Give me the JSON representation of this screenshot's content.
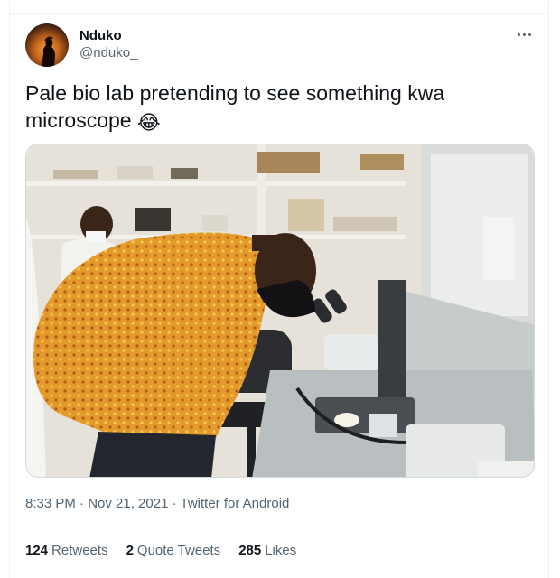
{
  "tweet": {
    "display_name": "Nduko",
    "handle": "@nduko_",
    "text": "Pale bio lab pretending to see something kwa microscope",
    "emoji": "😂",
    "timestamp": "8:33 PM · Nov 21, 2021 · Twitter for Android",
    "retweets_count": "124",
    "retweets_label": "Retweets",
    "quote_count": "2",
    "quote_label": "Quote Tweets",
    "likes_count": "285",
    "likes_label": "Likes"
  },
  "icons": {
    "more": "more-horizontal-icon",
    "avatar": "profile-avatar"
  }
}
